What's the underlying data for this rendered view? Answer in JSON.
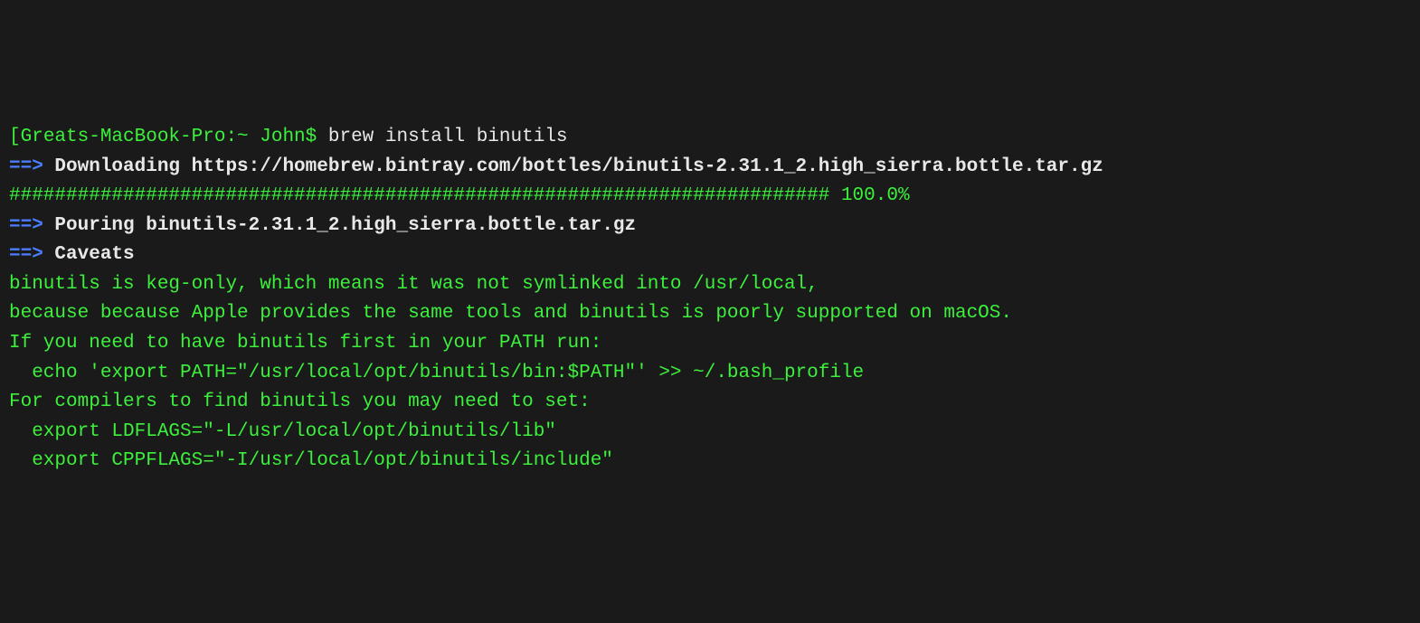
{
  "prompt": {
    "bracket": "[",
    "host_path": "Greats-MacBook-Pro:~ John$ ",
    "command": "brew install binutils"
  },
  "lines": {
    "download_arrow": "==>",
    "download_label": " Downloading https://homebrew.bintray.com/bottles/binutils-2.31.1_2.high_sierra.bottle.tar.gz",
    "progress": "######################################################################## 100.0%",
    "pouring_arrow": "==>",
    "pouring_label": " Pouring binutils-2.31.1_2.high_sierra.bottle.tar.gz",
    "caveats_arrow": "==>",
    "caveats_label": " Caveats",
    "body1": "binutils is keg-only, which means it was not symlinked into /usr/local,",
    "body2": "because because Apple provides the same tools and binutils is poorly supported on macOS.",
    "blank1": "",
    "body3": "If you need to have binutils first in your PATH run:",
    "body4": "  echo 'export PATH=\"/usr/local/opt/binutils/bin:$PATH\"' >> ~/.bash_profile",
    "blank2": "",
    "body5": "For compilers to find binutils you may need to set:",
    "body6": "  export LDFLAGS=\"-L/usr/local/opt/binutils/lib\"",
    "body7": "  export CPPFLAGS=\"-I/usr/local/opt/binutils/include\""
  }
}
